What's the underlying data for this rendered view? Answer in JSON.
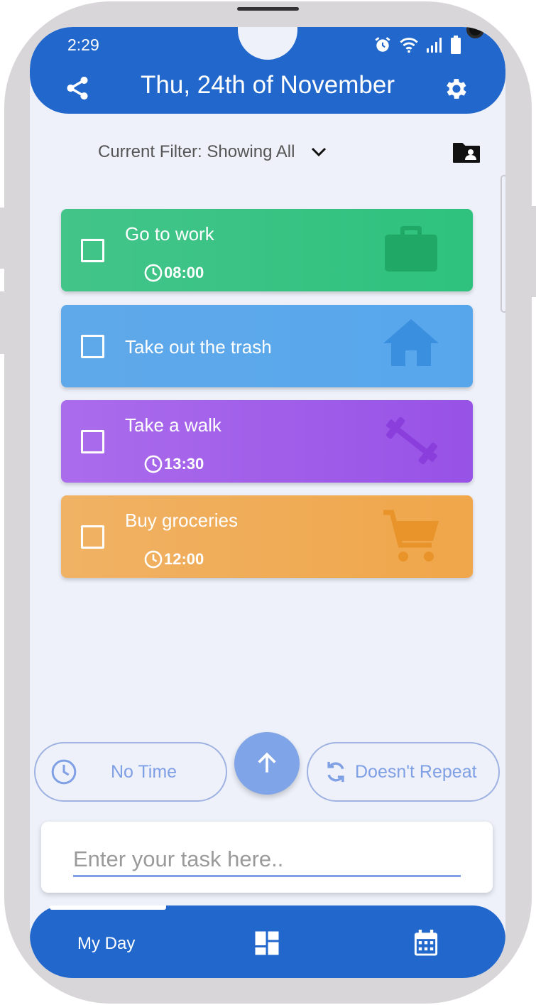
{
  "status_bar": {
    "time": "2:29"
  },
  "header": {
    "title": "Thu, 24th of November"
  },
  "filter": {
    "label": "Current Filter: Showing All"
  },
  "tasks": [
    {
      "title": "Go to work",
      "time": "08:00",
      "color": "#2ec27e",
      "icon": "briefcase-icon"
    },
    {
      "title": "Take out the trash",
      "time": "",
      "color": "#5aa8ec",
      "icon": "home-icon"
    },
    {
      "title": "Take a walk",
      "time": "13:30",
      "color": "#a25be8",
      "icon": "dumbbell-icon"
    },
    {
      "title": "Buy groceries",
      "time": "12:00",
      "color": "#f0ac4f",
      "icon": "cart-icon"
    }
  ],
  "composer": {
    "time_label": "No Time",
    "repeat_label": "Doesn't Repeat",
    "placeholder": "Enter your task here.."
  },
  "bottom_nav": {
    "my_day_label": "My Day"
  },
  "colors": {
    "primary": "#2268cc",
    "accent": "#7fa0e4",
    "background": "#eef1fa"
  }
}
